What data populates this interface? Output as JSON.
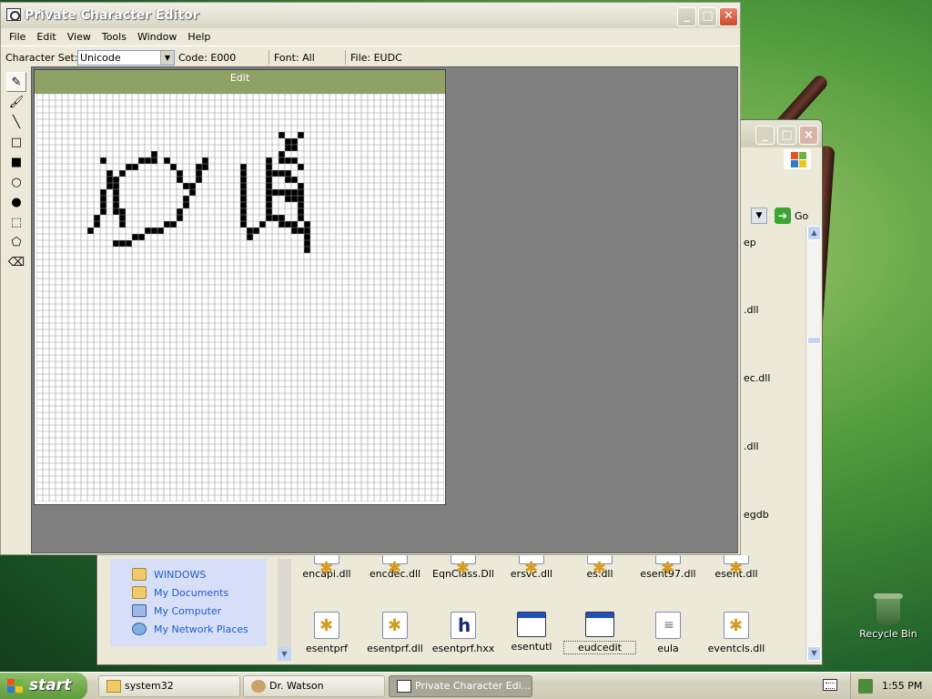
{
  "desktop": {
    "recycle_bin_label": "Recycle Bin"
  },
  "explorer": {
    "go_label": "Go",
    "partial_labels": [
      "ep",
      ".dll",
      "ec.dll",
      ".dll",
      "egdb"
    ],
    "places": [
      "WINDOWS",
      "My Documents",
      "My Computer",
      "My Network Places"
    ],
    "files_row1": [
      "encapi.dll",
      "encdec.dll",
      "EqnClass.Dll",
      "ersvc.dll",
      "es.dll",
      "esent97.dll",
      "esent.dll"
    ],
    "files_row2": [
      {
        "name": "esentprf",
        "icon": "gear"
      },
      {
        "name": "esentprf.dll",
        "icon": "gear"
      },
      {
        "name": "esentprf.hxx",
        "icon": "h"
      },
      {
        "name": "esentutl",
        "icon": "win"
      },
      {
        "name": "eudcedit",
        "icon": "win"
      },
      {
        "name": "eula",
        "icon": "doc"
      },
      {
        "name": "eventcls.dll",
        "icon": "gear"
      }
    ]
  },
  "pce": {
    "title": "Private Character Editor",
    "menu": [
      "File",
      "Edit",
      "View",
      "Tools",
      "Window",
      "Help"
    ],
    "info": {
      "charset_label": "Character Set:",
      "charset_value": "Unicode",
      "code": "Code: E000",
      "font": "Font: All",
      "file": "File: EUDC"
    },
    "tools": [
      "pencil",
      "brush",
      "line",
      "hollow-rectangle",
      "filled-rectangle",
      "hollow-ellipse",
      "filled-ellipse",
      "rectangular-selection",
      "freeform-selection",
      "eraser"
    ],
    "edit_window_title": "Edit",
    "grid": {
      "columns": 64,
      "rows": 64,
      "filled_cells": [
        [
          10,
          10
        ],
        [
          11,
          12
        ],
        [
          11,
          13
        ],
        [
          11,
          14
        ],
        [
          10,
          15
        ],
        [
          10,
          16
        ],
        [
          10,
          17
        ],
        [
          10,
          18
        ],
        [
          9,
          19
        ],
        [
          9,
          20
        ],
        [
          8,
          21
        ],
        [
          12,
          13
        ],
        [
          12,
          14
        ],
        [
          12,
          15
        ],
        [
          12,
          16
        ],
        [
          12,
          17
        ],
        [
          12,
          18
        ],
        [
          13,
          18
        ],
        [
          13,
          19
        ],
        [
          13,
          20
        ],
        [
          13,
          12
        ],
        [
          14,
          11
        ],
        [
          15,
          11
        ],
        [
          16,
          10
        ],
        [
          17,
          10
        ],
        [
          18,
          9
        ],
        [
          18,
          10
        ],
        [
          12,
          23
        ],
        [
          13,
          23
        ],
        [
          14,
          23
        ],
        [
          15,
          22
        ],
        [
          16,
          22
        ],
        [
          17,
          21
        ],
        [
          18,
          21
        ],
        [
          19,
          21
        ],
        [
          20,
          20
        ],
        [
          21,
          20
        ],
        [
          22,
          19
        ],
        [
          22,
          18
        ],
        [
          23,
          17
        ],
        [
          23,
          16
        ],
        [
          24,
          15
        ],
        [
          24,
          14
        ],
        [
          25,
          13
        ],
        [
          25,
          12
        ],
        [
          25,
          11
        ],
        [
          26,
          11
        ],
        [
          26,
          10
        ],
        [
          20,
          10
        ],
        [
          21,
          11
        ],
        [
          22,
          12
        ],
        [
          22,
          13
        ],
        [
          23,
          14
        ],
        [
          38,
          6
        ],
        [
          39,
          7
        ],
        [
          40,
          7
        ],
        [
          41,
          6
        ],
        [
          39,
          8
        ],
        [
          40,
          8
        ],
        [
          38,
          9
        ],
        [
          38,
          10
        ],
        [
          39,
          10
        ],
        [
          40,
          10
        ],
        [
          41,
          11
        ],
        [
          32,
          11
        ],
        [
          32,
          12
        ],
        [
          32,
          13
        ],
        [
          32,
          14
        ],
        [
          32,
          15
        ],
        [
          32,
          16
        ],
        [
          32,
          17
        ],
        [
          32,
          18
        ],
        [
          32,
          19
        ],
        [
          32,
          20
        ],
        [
          33,
          21
        ],
        [
          33,
          22
        ],
        [
          34,
          21
        ],
        [
          35,
          20
        ],
        [
          36,
          10
        ],
        [
          36,
          11
        ],
        [
          36,
          12
        ],
        [
          36,
          13
        ],
        [
          36,
          14
        ],
        [
          36,
          15
        ],
        [
          36,
          16
        ],
        [
          36,
          17
        ],
        [
          36,
          18
        ],
        [
          36,
          19
        ],
        [
          37,
          12
        ],
        [
          38,
          12
        ],
        [
          39,
          12
        ],
        [
          39,
          13
        ],
        [
          40,
          13
        ],
        [
          37,
          15
        ],
        [
          38,
          15
        ],
        [
          39,
          15
        ],
        [
          40,
          15
        ],
        [
          39,
          16
        ],
        [
          40,
          16
        ],
        [
          41,
          14
        ],
        [
          41,
          15
        ],
        [
          41,
          16
        ],
        [
          41,
          17
        ],
        [
          41,
          18
        ],
        [
          41,
          19
        ],
        [
          37,
          19
        ],
        [
          38,
          19
        ],
        [
          38,
          20
        ],
        [
          39,
          20
        ],
        [
          40,
          20
        ],
        [
          40,
          21
        ],
        [
          41,
          21
        ],
        [
          42,
          20
        ],
        [
          42,
          21
        ],
        [
          42,
          22
        ],
        [
          42,
          23
        ],
        [
          42,
          24
        ]
      ]
    }
  },
  "taskbar": {
    "start_label": "start",
    "buttons": [
      "system32",
      "Dr. Watson",
      "Private Character Edi..."
    ],
    "clock": "1:55 PM"
  }
}
